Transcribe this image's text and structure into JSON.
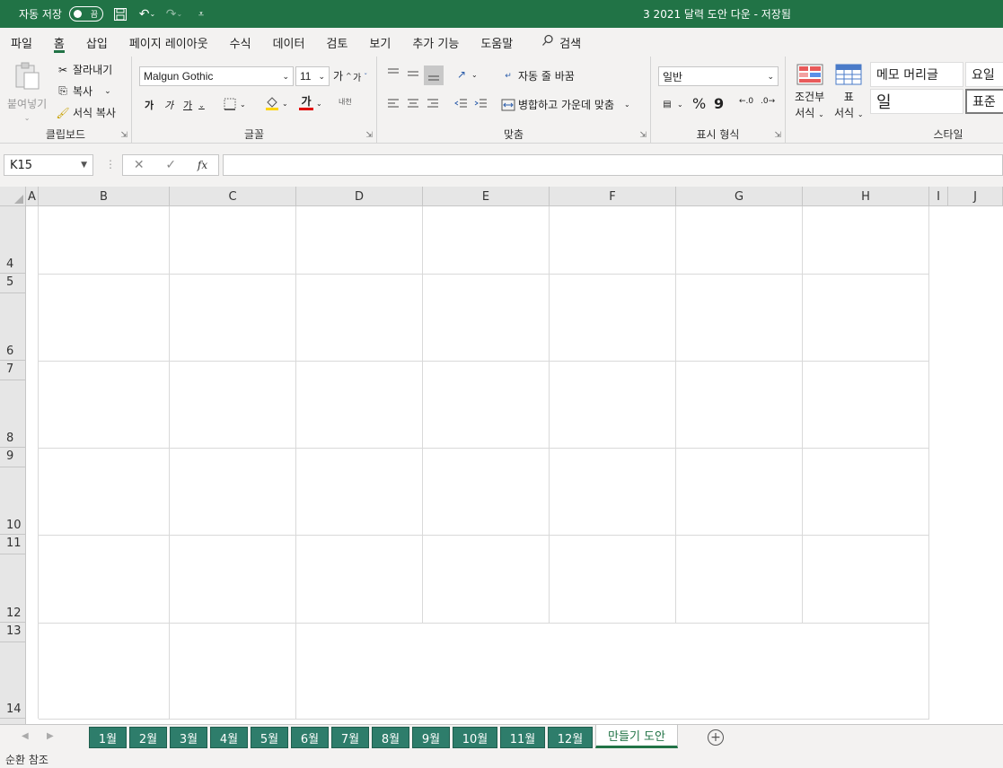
{
  "titlebar": {
    "autosave_label": "자동 저장",
    "autosave_state": "끔",
    "title": "3 2021 달력 도안 다운  -  저장됨"
  },
  "menu": {
    "tabs": [
      "파일",
      "홈",
      "삽입",
      "페이지 레이아웃",
      "수식",
      "데이터",
      "검토",
      "보기",
      "추가 기능",
      "도움말"
    ],
    "active": "홈",
    "search": "검색"
  },
  "ribbon": {
    "clipboard": {
      "paste": "붙여넣기",
      "cut": "잘라내기",
      "copy": "복사",
      "format_painter": "서식 복사",
      "label": "클립보드"
    },
    "font": {
      "name": "Malgun Gothic",
      "size": "11",
      "bold": "가",
      "italic": "가",
      "underline": "가",
      "font_color_glyph": "가",
      "phonetic": "내천",
      "label": "글꼴"
    },
    "alignment": {
      "wrap_text": "자동 줄 바꿈",
      "merge_center": "병합하고 가운데 맞춤",
      "label": "맞춤"
    },
    "number": {
      "format": "일반",
      "percent": "%",
      "comma": "9",
      "label": "표시 형식"
    },
    "styles": {
      "conditional_line1": "조건부",
      "conditional_line2": "서식",
      "table_line1": "표",
      "table_line2": "서식",
      "style_memo": "메모 머리글",
      "style_day": "요일",
      "style_il": "일",
      "style_normal": "표준",
      "label": "스타일"
    }
  },
  "formula_bar": {
    "cell_ref": "K15",
    "fx": "fx",
    "formula": ""
  },
  "grid": {
    "columns": [
      "A",
      "B",
      "C",
      "D",
      "E",
      "F",
      "G",
      "H",
      "I",
      "J"
    ],
    "rows": [
      "4",
      "5",
      "6",
      "7",
      "8",
      "9",
      "10",
      "11",
      "12",
      "13",
      "14"
    ]
  },
  "sheets": {
    "tabs": [
      "1월",
      "2월",
      "3월",
      "4월",
      "5월",
      "6월",
      "7월",
      "8월",
      "9월",
      "10월",
      "11월",
      "12월",
      "만들기 도안"
    ],
    "active": "만들기 도안"
  },
  "status": {
    "text": "순환 참조"
  }
}
